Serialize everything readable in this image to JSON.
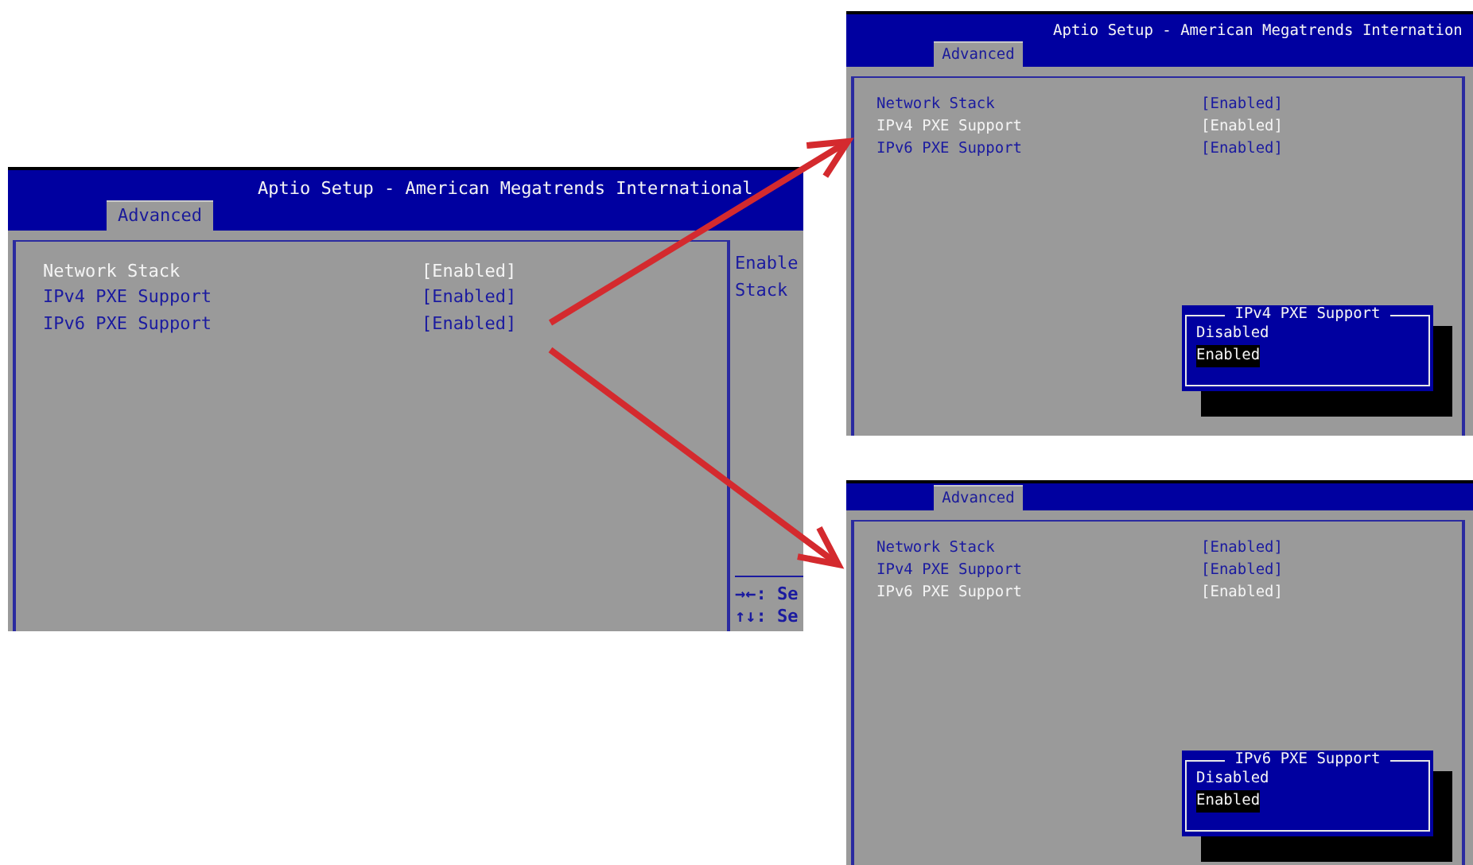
{
  "screens": [
    {
      "title": "Aptio Setup - American Megatrends International",
      "tab": "Advanced",
      "items": [
        {
          "label": "Network Stack",
          "value": "[Enabled]",
          "selected": true
        },
        {
          "label": "IPv4 PXE Support",
          "value": "[Enabled]",
          "selected": false
        },
        {
          "label": "IPv6 PXE Support",
          "value": "[Enabled]",
          "selected": false
        }
      ],
      "help": [
        "Enable",
        "Stack"
      ],
      "keys": [
        "→←: Se",
        "↑↓: Se"
      ]
    },
    {
      "title": "Aptio Setup - American Megatrends Internation",
      "tab": "Advanced",
      "items": [
        {
          "label": "Network Stack",
          "value": "[Enabled]",
          "selected": false
        },
        {
          "label": "IPv4 PXE Support",
          "value": "[Enabled]",
          "selected": true
        },
        {
          "label": "IPv6 PXE Support",
          "value": "[Enabled]",
          "selected": false
        }
      ],
      "popup": {
        "title": "IPv4 PXE Support",
        "options": [
          {
            "label": "Disabled",
            "selected": false
          },
          {
            "label": "Enabled",
            "selected": true
          }
        ]
      }
    },
    {
      "tab": "Advanced",
      "items": [
        {
          "label": "Network Stack",
          "value": "[Enabled]",
          "selected": false
        },
        {
          "label": "IPv4 PXE Support",
          "value": "[Enabled]",
          "selected": false
        },
        {
          "label": "IPv6 PXE Support",
          "value": "[Enabled]",
          "selected": true
        }
      ],
      "popup": {
        "title": "IPv6 PXE Support",
        "options": [
          {
            "label": "Disabled",
            "selected": false
          },
          {
            "label": "Enabled",
            "selected": true
          }
        ]
      }
    }
  ]
}
